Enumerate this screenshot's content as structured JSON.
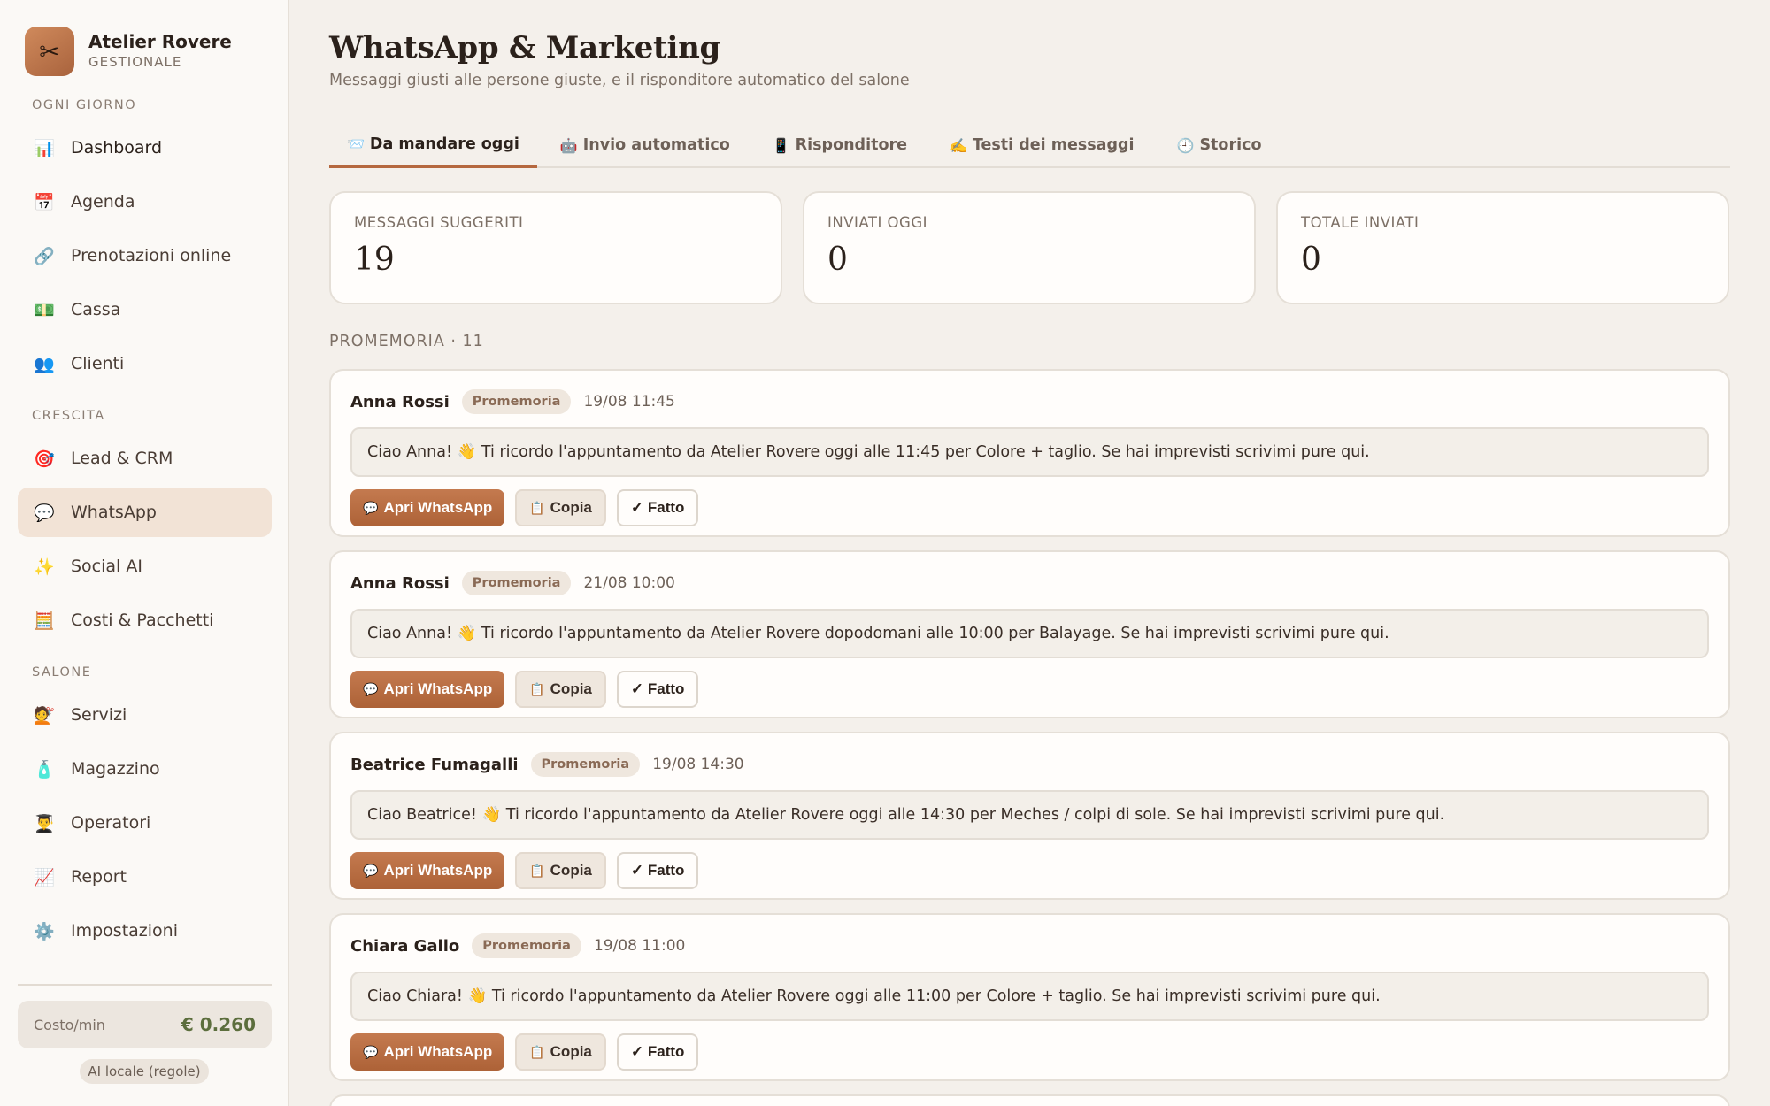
{
  "brand": {
    "name": "Atelier Rovere",
    "subtitle": "GESTIONALE",
    "logo_icon": "✂"
  },
  "sidebar": {
    "sections": [
      {
        "title": "OGNI GIORNO"
      },
      {
        "title": "CRESCITA"
      },
      {
        "title": "SALONE"
      }
    ],
    "items": [
      {
        "label": "Dashboard",
        "icon": "📊",
        "active": false
      },
      {
        "label": "Agenda",
        "icon": "📅",
        "active": false
      },
      {
        "label": "Prenotazioni online",
        "icon": "🔗",
        "active": false
      },
      {
        "label": "Cassa",
        "icon": "💵",
        "active": false
      },
      {
        "label": "Clienti",
        "icon": "👥",
        "active": false
      },
      {
        "label": "Lead & CRM",
        "icon": "🎯",
        "active": false
      },
      {
        "label": "WhatsApp",
        "icon": "💬",
        "active": true
      },
      {
        "label": "Social AI",
        "icon": "✨",
        "active": false
      },
      {
        "label": "Costi & Pacchetti",
        "icon": "🧮",
        "active": false
      },
      {
        "label": "Servizi",
        "icon": "💇",
        "active": false
      },
      {
        "label": "Magazzino",
        "icon": "🧴",
        "active": false
      },
      {
        "label": "Operatori",
        "icon": "👨‍🎓",
        "active": false
      },
      {
        "label": "Report",
        "icon": "📈",
        "active": false
      },
      {
        "label": "Impostazioni",
        "icon": "⚙️",
        "active": false
      }
    ],
    "cost": {
      "label": "Costo/min",
      "value": "€ 0.260"
    },
    "mode": "AI locale (regole)"
  },
  "page": {
    "title": "WhatsApp & Marketing",
    "subtitle": "Messaggi giusti alle persone giuste, e il risponditore automatico del salone"
  },
  "tabs": [
    {
      "label": "Da mandare oggi",
      "icon": "📨",
      "active": true
    },
    {
      "label": "Invio automatico",
      "icon": "🤖",
      "active": false
    },
    {
      "label": "Risponditore",
      "icon": "📱",
      "active": false
    },
    {
      "label": "Testi dei messaggi",
      "icon": "✍️",
      "active": false
    },
    {
      "label": "Storico",
      "icon": "🕘",
      "active": false
    }
  ],
  "stats": [
    {
      "label": "MESSAGGI SUGGERITI",
      "value": "19"
    },
    {
      "label": "INVIATI OGGI",
      "value": "0"
    },
    {
      "label": "TOTALE INVIATI",
      "value": "0"
    }
  ],
  "section": {
    "heading": "PROMEMORIA · 11"
  },
  "actions": {
    "open_label": "Apri WhatsApp",
    "open_icon": "💬",
    "copy_label": "Copia",
    "copy_icon": "📋",
    "done_label": "✓ Fatto"
  },
  "messages": [
    {
      "name": "Anna Rossi",
      "badge": "Promemoria",
      "time": "19/08 11:45",
      "text": "Ciao Anna! 👋 Ti ricordo l'appuntamento da Atelier Rovere oggi alle 11:45 per Colore + taglio. Se hai imprevisti scrivimi pure qui."
    },
    {
      "name": "Anna Rossi",
      "badge": "Promemoria",
      "time": "21/08 10:00",
      "text": "Ciao Anna! 👋 Ti ricordo l'appuntamento da Atelier Rovere dopodomani alle 10:00 per Balayage. Se hai imprevisti scrivimi pure qui."
    },
    {
      "name": "Beatrice Fumagalli",
      "badge": "Promemoria",
      "time": "19/08 14:30",
      "text": "Ciao Beatrice! 👋 Ti ricordo l'appuntamento da Atelier Rovere oggi alle 14:30 per Meches / colpi di sole. Se hai imprevisti scrivimi pure qui."
    },
    {
      "name": "Chiara Gallo",
      "badge": "Promemoria",
      "time": "19/08 11:00",
      "text": "Ciao Chiara! 👋 Ti ricordo l'appuntamento da Atelier Rovere oggi alle 11:00 per Colore + taglio. Se hai imprevisti scrivimi pure qui."
    }
  ]
}
